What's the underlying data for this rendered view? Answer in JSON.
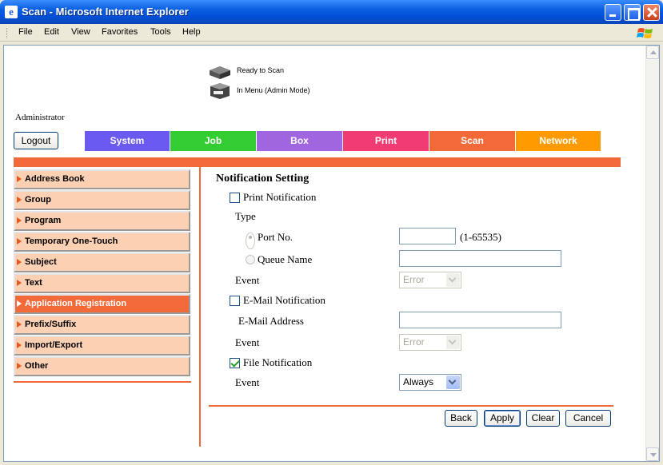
{
  "window": {
    "title": "Scan - Microsoft Internet Explorer",
    "icon": "ie-page-icon"
  },
  "menu": [
    "File",
    "Edit",
    "View",
    "Favorites",
    "Tools",
    "Help"
  ],
  "status": {
    "scan_status": "Ready to Scan",
    "mode_status": "In Menu (Admin Mode)"
  },
  "user": {
    "role": "Administrator",
    "logout_label": "Logout"
  },
  "tabs": [
    {
      "label": "System",
      "color": "#6A5AF0"
    },
    {
      "label": "Job",
      "color": "#33CC33"
    },
    {
      "label": "Box",
      "color": "#A066E0"
    },
    {
      "label": "Print",
      "color": "#F03C73"
    },
    {
      "label": "Scan",
      "color": "#F26A3A"
    },
    {
      "label": "Network",
      "color": "#FF9A00"
    }
  ],
  "sidebar": {
    "items": [
      {
        "label": "Address Book"
      },
      {
        "label": "Group"
      },
      {
        "label": "Program"
      },
      {
        "label": "Temporary One-Touch"
      },
      {
        "label": "Subject"
      },
      {
        "label": "Text"
      },
      {
        "label": "Application Registration",
        "active": true
      },
      {
        "label": "Prefix/Suffix"
      },
      {
        "label": "Import/Export"
      },
      {
        "label": "Other"
      }
    ]
  },
  "form": {
    "title": "Notification Setting",
    "print_notification": {
      "label": "Print Notification",
      "checked": false
    },
    "type_label": "Type",
    "port_no": {
      "label": "Port No.",
      "selected": true,
      "value": "",
      "range": "(1-65535)"
    },
    "queue_name": {
      "label": "Queue Name",
      "selected": false,
      "value": ""
    },
    "event1": {
      "label": "Event",
      "value": "Error",
      "enabled": false
    },
    "email_notification": {
      "label": "E-Mail Notification",
      "checked": false
    },
    "email_address": {
      "label": "E-Mail Address",
      "value": ""
    },
    "event2": {
      "label": "Event",
      "value": "Error",
      "enabled": false
    },
    "file_notification": {
      "label": "File Notification",
      "checked": true
    },
    "event3": {
      "label": "Event",
      "value": "Always",
      "enabled": true
    }
  },
  "buttons": {
    "back": "Back",
    "apply": "Apply",
    "clear": "Clear",
    "cancel": "Cancel"
  },
  "colors": {
    "accent": "#F26A3A",
    "side_bg": "#FCD0B2"
  }
}
